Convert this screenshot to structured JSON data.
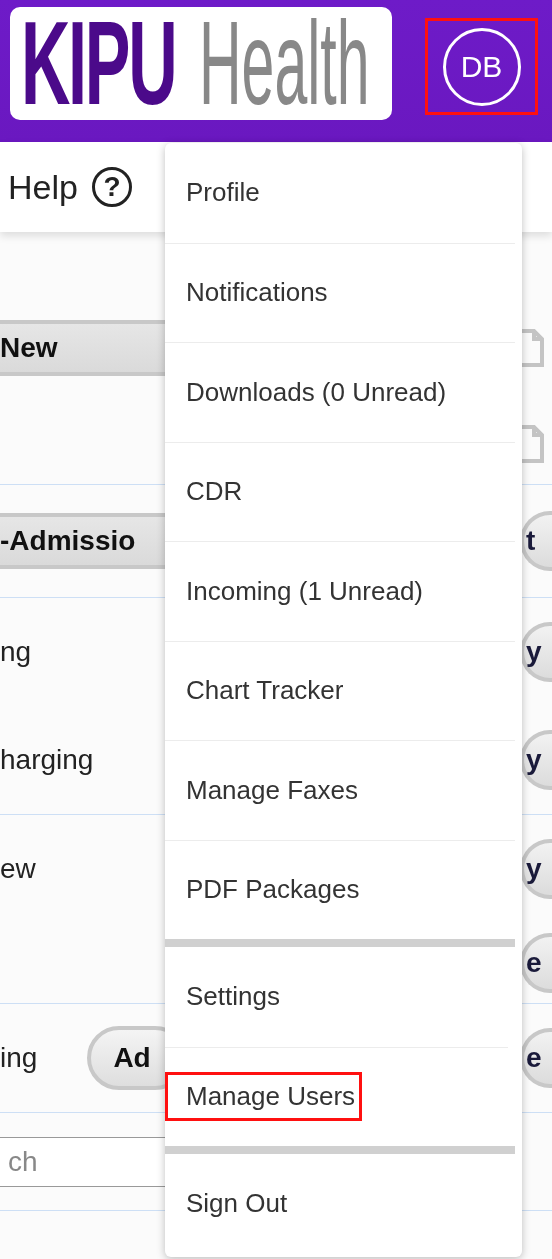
{
  "header": {
    "logo": {
      "bold": "KIPU",
      "light": "Health"
    },
    "avatar": {
      "initials": "DB",
      "highlighted": true
    }
  },
  "toolbar": {
    "help": "Help",
    "help_icon": "?"
  },
  "sections": [
    {
      "rows": [
        {
          "kind": "bar",
          "label": "New",
          "side": {
            "kind": "document"
          }
        },
        {
          "kind": "blank",
          "side": {
            "kind": "document"
          }
        }
      ]
    },
    {
      "rows": [
        {
          "kind": "bar",
          "label": "-Admissio",
          "side": {
            "kind": "button",
            "label": "t"
          }
        }
      ]
    },
    {
      "rows": [
        {
          "kind": "text",
          "label": "ng",
          "side": {
            "kind": "button",
            "label": "y"
          }
        },
        {
          "kind": "text",
          "label": "harging",
          "side": {
            "kind": "button",
            "label": "y"
          }
        }
      ]
    },
    {
      "rows": [
        {
          "kind": "text",
          "label": "ew",
          "side": {
            "kind": "button",
            "label": "y"
          }
        },
        {
          "kind": "blank",
          "side": {
            "kind": "button",
            "label": "e"
          }
        }
      ]
    },
    {
      "rows": [
        {
          "kind": "text",
          "label": "ing",
          "button": "Ad",
          "side": {
            "kind": "button",
            "label": "e"
          }
        }
      ]
    },
    {
      "rows": [
        {
          "kind": "field",
          "placeholder": "ch"
        }
      ]
    }
  ],
  "menu": {
    "groups": [
      {
        "items": [
          {
            "label": "Profile",
            "highlighted": false
          },
          {
            "label": "Notifications",
            "highlighted": false
          },
          {
            "label": "Downloads (0 Unread)",
            "highlighted": false
          },
          {
            "label": "CDR",
            "highlighted": false
          },
          {
            "label": "Incoming (1 Unread)",
            "highlighted": false
          },
          {
            "label": "Chart Tracker",
            "highlighted": false
          },
          {
            "label": "Manage Faxes",
            "highlighted": false
          },
          {
            "label": "PDF Packages",
            "highlighted": false
          }
        ]
      },
      {
        "items": [
          {
            "label": "Settings",
            "highlighted": false
          },
          {
            "label": "Manage Users",
            "highlighted": true
          }
        ]
      },
      {
        "items": [
          {
            "label": "Sign Out",
            "highlighted": false
          }
        ]
      }
    ]
  }
}
